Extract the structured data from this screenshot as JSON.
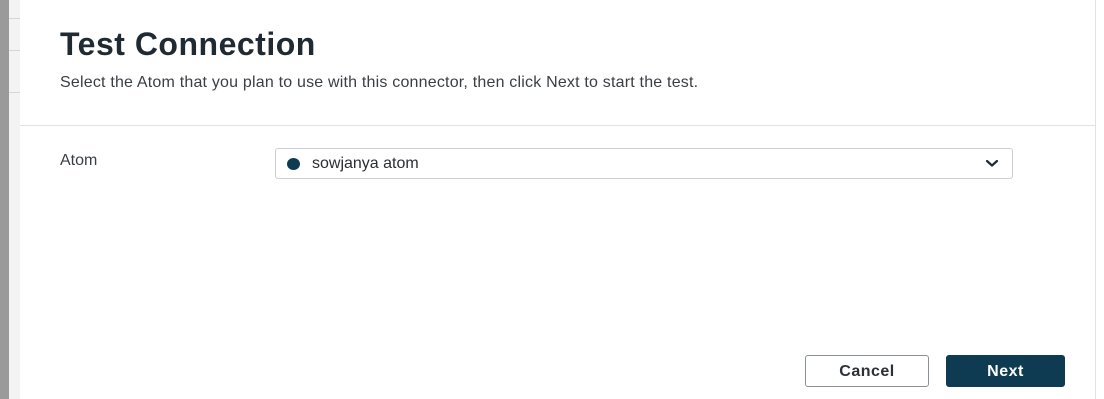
{
  "dialog": {
    "title": "Test Connection",
    "description": "Select the Atom that you plan to use with this connector, then click Next to start the test."
  },
  "form": {
    "atom_label": "Atom",
    "atom_select": {
      "selected_value": "sowjanya atom",
      "status_icon": "status-dot-icon",
      "status_color": "#0f3b52",
      "dropdown_icon": "chevron-down-icon"
    }
  },
  "footer": {
    "cancel_label": "Cancel",
    "next_label": "Next"
  },
  "colors": {
    "primary": "#0f3b52",
    "title_text": "#1f2a33",
    "body_text": "#3a3f44",
    "border": "#c9ced3"
  }
}
